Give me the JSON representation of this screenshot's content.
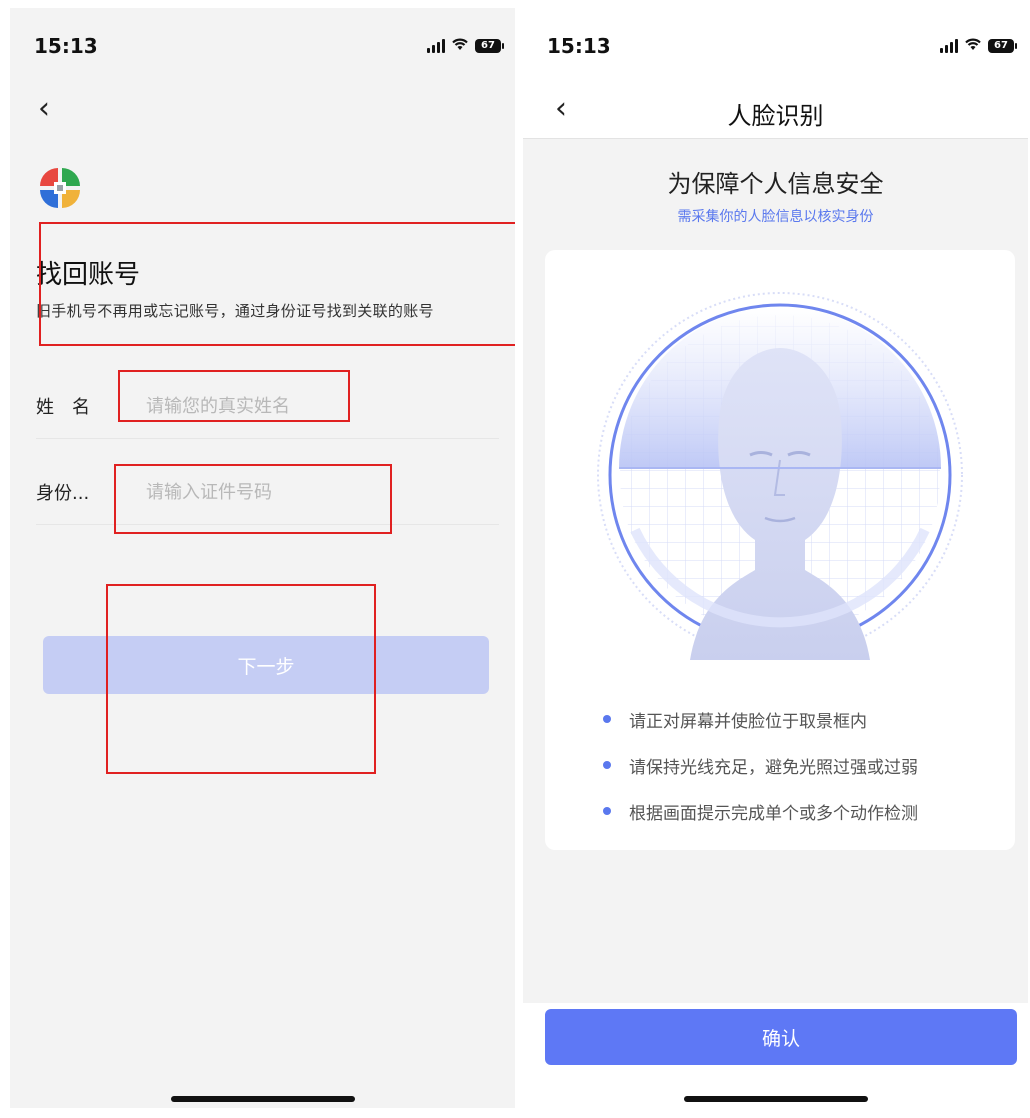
{
  "left_screen": {
    "status": {
      "time": "15:13",
      "battery": "67"
    },
    "title": "找回账号",
    "subtitle": "旧手机号不再用或忘记账号，通过身份证号找到关联的账号",
    "form": {
      "name_label": "姓　名",
      "name_placeholder": "请输您的真实姓名",
      "id_label": "身份...",
      "id_placeholder": "请输入证件号码"
    },
    "next_button": "下一步"
  },
  "right_screen": {
    "status": {
      "time": "15:13",
      "battery": "67"
    },
    "nav_title": "人脸识别",
    "heading": "为保障个人信息安全",
    "subheading": "需采集你的人脸信息以核实身份",
    "tips": [
      "请正对屏幕并使脸位于取景框内",
      "请保持光线充足，避免光照过强或过弱",
      "根据画面提示完成单个或多个动作检测"
    ],
    "confirm_button": "确认"
  },
  "colors": {
    "accent": "#5e78f5",
    "accent_disabled": "#c5cdf4",
    "highlight_box": "#e02020"
  }
}
